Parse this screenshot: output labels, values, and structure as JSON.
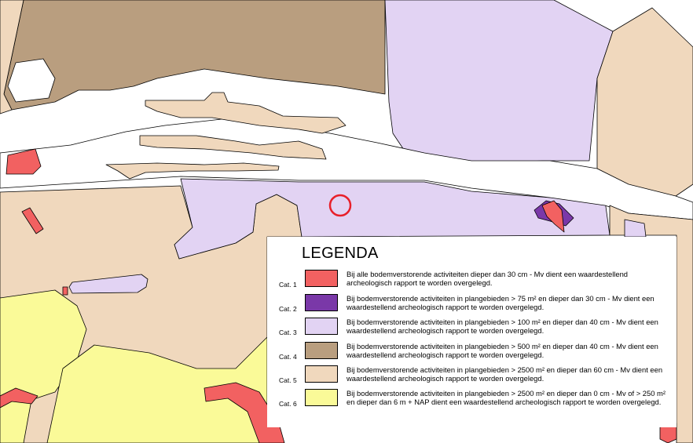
{
  "colors": {
    "cat1": "#f26161",
    "cat2": "#7a38a8",
    "cat3": "#e2d3f3",
    "cat4": "#b99e7f",
    "cat5": "#f0d8bd",
    "cat6": "#fafa98",
    "water": "#ffffff",
    "marker": "#e8202a"
  },
  "legend": {
    "title": "LEGENDA",
    "items": [
      {
        "category": "Cat. 1",
        "color": "#f26161",
        "text": "Bij alle bodemverstorende activiteiten dieper dan 30 cm - Mv dient een waardestellend archeologisch rapport te worden overgelegd."
      },
      {
        "category": "Cat. 2",
        "color": "#7a38a8",
        "text": "Bij bodemverstorende activiteiten in plangebieden > 75 m² en dieper dan 30 cm - Mv dient een waardestellend archeologisch rapport te worden overgelegd."
      },
      {
        "category": "Cat. 3",
        "color": "#e2d3f3",
        "text": "Bij bodemverstorende activiteiten in plangebieden > 100 m² en dieper dan 40 cm - Mv dient een waardestellend archeologisch rapport te worden overgelegd."
      },
      {
        "category": "Cat. 4",
        "color": "#b99e7f",
        "text": "Bij bodemverstorende activiteiten in plangebieden > 500 m² en dieper dan 40 cm - Mv dient een waardestellend archeologisch rapport te worden overgelegd."
      },
      {
        "category": "Cat. 5",
        "color": "#f0d8bd",
        "text": "Bij bodemverstorende activiteiten in plangebieden > 2500 m² en dieper dan 60 cm - Mv dient een waardestellend archeologisch rapport te worden overgelegd."
      },
      {
        "category": "Cat. 6",
        "color": "#fafa98",
        "text": "Bij bodemverstorende activiteiten in plangebieden > 2500 m² en dieper dan 0 cm - Mv of > 250 m² en dieper dan 6 m + NAP dient een waardestellend archeologisch rapport te worden overgelegd."
      }
    ]
  }
}
